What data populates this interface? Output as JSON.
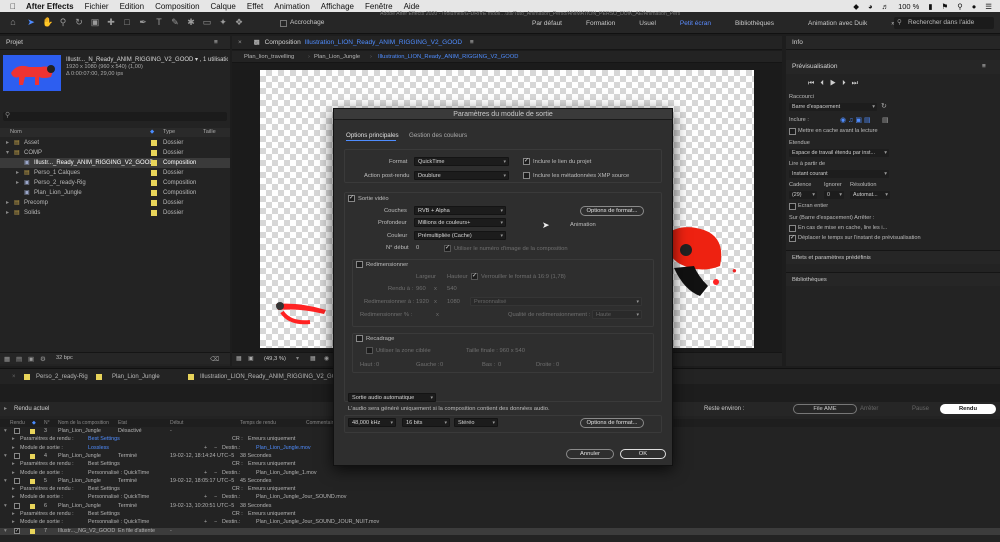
{
  "menubar": {
    "apple": "",
    "app": "After Effects",
    "items": [
      "Fichier",
      "Edition",
      "Composition",
      "Calque",
      "Effet",
      "Animation",
      "Affichage",
      "Fenêtre",
      "Aide"
    ],
    "battery": "100 %",
    "clock": ""
  },
  "toolbar": {
    "snap_label": "Accrochage",
    "title": "Adobe After Effects 2020 - /Volumes/G-DRIVE mobil…uts/Tuto_Animation_Perso/ANIMATION_PERSO_DUIK_AE/Animation_Perso_Duik.aep *",
    "workspaces": [
      "Par défaut",
      "Formation",
      "Usuel",
      "Petit écran",
      "Bibliothèques",
      "Animation avec Duik"
    ],
    "active_workspace": "Petit écran",
    "search_placeholder": "Rechercher dans l'aide"
  },
  "project": {
    "tab": "Projet",
    "comp_name": "Illustr..._N_Ready_ANIM_RIGGING_V2_GOOD ▾ , 1 utilisation",
    "comp_size": "1920 x 1080 (960 x 540) (1,00)",
    "comp_duration": "Δ 0:00:07:00, 29,00 ips",
    "col_name": "Nom",
    "col_type": "Type",
    "col_size": "Taille",
    "items": [
      {
        "name": "Asset",
        "type": "Dossier",
        "color": "#e8d45a"
      },
      {
        "name": "COMP",
        "type": "Dossier",
        "color": "#e8d45a"
      },
      {
        "name": "Illustr..._Ready_ANIM_RIGGING_V2_GOOD",
        "type": "Composition",
        "color": "#e8d45a"
      },
      {
        "name": "Perso_1 Calques",
        "type": "Dossier",
        "color": "#e8d45a"
      },
      {
        "name": "Perso_2_ready-Rig",
        "type": "Composition",
        "color": "#e8d45a"
      },
      {
        "name": "Plan_Lion_Jungle",
        "type": "Composition",
        "color": "#e8d45a"
      },
      {
        "name": "Precomp",
        "type": "Dossier",
        "color": "#e8d45a"
      },
      {
        "name": "Solids",
        "type": "Dossier",
        "color": "#e8d45a"
      }
    ],
    "bpc": "32 bpc"
  },
  "composition": {
    "tab_prefix": "Composition",
    "tab_name": "Illustration_LION_Ready_ANIM_RIGGING_V2_GOOD",
    "breadcrumbs": [
      "Plan_lion_travelling",
      "Plan_Lion_Jungle",
      "Illustration_LION_Ready_ANIM_RIGGING_V2_GOOD"
    ],
    "zoom": "(49,3 %)"
  },
  "timeline_tabs": [
    "Perso_2_ready-Rig",
    "Plan_Lion_Jungle",
    "Illustration_LION_Ready_ANIM_RIGGING_V2_GOOD"
  ],
  "dialog": {
    "title": "Paramètres du module de sortie",
    "tabs": [
      "Options principales",
      "Gestion des couleurs"
    ],
    "format_label": "Format",
    "format_value": "QuickTime",
    "include_project_link": "Inclure le lien du projet",
    "post_render_label": "Action post-rendu",
    "post_render_value": "Doublure",
    "include_xmp": "Inclure les métadonnées XMP source",
    "video_output": "Sortie vidéo",
    "channels_label": "Couches",
    "channels_value": "RVB + Alpha",
    "format_options": "Options de format...",
    "depth_label": "Profondeur",
    "depth_value": "Millions de couleurs+",
    "codec": "Animation",
    "color_label": "Couleur",
    "color_value": "Prémultipliée (Cache)",
    "start_label": "N° début",
    "start_value": "0",
    "use_comp_frame": "Utiliser le numéro d'image de la composition",
    "resize": "Redimensionner",
    "width_label": "Largeur",
    "height_label": "Hauteur",
    "lock_ratio": "Verrouiller le format à 16:9 (1,78)",
    "render_at_label": "Rendu à :",
    "render_w": "960",
    "render_h": "540",
    "resize_to_label": "Redimensionner à :",
    "resize_w": "1920",
    "resize_h": "1080",
    "custom": "Personnalisé",
    "resize_pct_label": "Redimensionner % :",
    "resize_x": "x",
    "quality_label": "Qualité de redimensionnement :",
    "quality_value": "Haute",
    "crop": "Recadrage",
    "use_roi": "Utiliser la zone ciblée",
    "final_size": "Taille finale : 960 x 540",
    "top_label": "Haut :",
    "top_v": "0",
    "left_label": "Gauche :",
    "left_v": "0",
    "bottom_label": "Bas :",
    "bottom_v": "0",
    "right_label": "Droite :",
    "right_v": "0",
    "audio_auto": "Sortie audio automatique",
    "audio_note": "L'audio sera généré uniquement si la composition contient des données audio.",
    "sample_rate": "48,000 kHz",
    "bit_depth": "16 bits",
    "channels_audio": "Stéréo",
    "audio_format_options": "Options de format...",
    "cancel": "Annuler",
    "ok": "OK"
  },
  "right_panel": {
    "info": "Info",
    "preview": "Prévisualisation",
    "shortcut_label": "Raccourci",
    "shortcut_value": "Barre d'espacement",
    "include_label": "Inclure :",
    "cache_before": "Mettre en cache avant la lecture",
    "range_label": "Etendue",
    "range_value": "Espace de travail étendu par inst...",
    "play_from_label": "Lire à partir de",
    "play_from_value": "Instant courant",
    "frame_rate_label": "Cadence",
    "skip_label": "Ignorer",
    "resolution_label": "Résolution",
    "frame_rate": "(29)",
    "skip": "0",
    "resolution": "Automat...",
    "full_screen": "Ecran entier",
    "stop_label": "Sur (Barre d'espacement) Arrêter :",
    "if_cache": "En cas de mise en cache, lire les i...",
    "move_time": "Déplacer le temps sur l'instant de prévisualisation",
    "effects": "Effets et paramètres prédéfinis",
    "libraries": "Bibliothèques"
  },
  "render_queue": {
    "current_render": "Rendu actuel",
    "remaining": "Reste environ :",
    "ame_button": "File AME",
    "stop_button": "Arrêter",
    "pause_button": "Pause",
    "render_button": "Rendu",
    "columns": [
      "Rendu",
      "N°",
      "Nom de la composition",
      "Etat",
      "Début",
      "Temps de rendu",
      "Commentaire"
    ],
    "rows": [
      {
        "kind": "item",
        "num": "3",
        "name": "Plan_Lion_Jungle",
        "status": "Désactivé",
        "start": "-",
        "time": ""
      },
      {
        "kind": "settings",
        "label": "Paramètres de rendu :",
        "value": "Best Settings",
        "blue": true,
        "log_label": "CR :",
        "log": "Erreurs uniquement"
      },
      {
        "kind": "module",
        "label": "Module de sortie :",
        "value": "Lossless",
        "blue": true,
        "dest_label": "Destin.:",
        "dest": "Plan_Lion_Jungle.mov",
        "dest_blue": true
      },
      {
        "kind": "item",
        "num": "4",
        "name": "Plan_Lion_Jungle",
        "status": "Terminé",
        "start": "19-02-12, 18:14:24 UTC−5",
        "time": "38 Secondes"
      },
      {
        "kind": "settings",
        "label": "Paramètres de rendu :",
        "value": "Best Settings",
        "blue": false,
        "log_label": "CR :",
        "log": "Erreurs uniquement"
      },
      {
        "kind": "module",
        "label": "Module de sortie :",
        "value": "Personnalisé : QuickTime",
        "blue": false,
        "dest_label": "Destin.:",
        "dest": "Plan_Lion_Jungle_1.mov",
        "dest_blue": false
      },
      {
        "kind": "item",
        "num": "5",
        "name": "Plan_Lion_Jungle",
        "status": "Terminé",
        "start": "19-02-12, 18:05:17 UTC−5",
        "time": "45 Secondes"
      },
      {
        "kind": "settings",
        "label": "Paramètres de rendu :",
        "value": "Best Settings",
        "blue": false,
        "log_label": "CR :",
        "log": "Erreurs uniquement"
      },
      {
        "kind": "module",
        "label": "Module de sortie :",
        "value": "Personnalisé : QuickTime",
        "blue": false,
        "dest_label": "Destin.:",
        "dest": "Plan_Lion_Jungle_Jour_SOUND.mov",
        "dest_blue": false
      },
      {
        "kind": "item",
        "num": "6",
        "name": "Plan_Lion_Jungle",
        "status": "Terminé",
        "start": "19-02-13, 10:20:51 UTC−5",
        "time": "38 Secondes"
      },
      {
        "kind": "settings",
        "label": "Paramètres de rendu :",
        "value": "Best Settings",
        "blue": false,
        "log_label": "CR :",
        "log": "Erreurs uniquement"
      },
      {
        "kind": "module",
        "label": "Module de sortie :",
        "value": "Personnalisé : QuickTime",
        "blue": false,
        "dest_label": "Destin.:",
        "dest": "Plan_Lion_Jungle_Jour_SOUND_JOUR_NUIT.mov",
        "dest_blue": false
      },
      {
        "kind": "item",
        "num": "7",
        "name": "Illustr..._NG_V2_GOOD",
        "status": "En file d'attente",
        "start": "-",
        "time": "",
        "selected": true
      }
    ]
  }
}
